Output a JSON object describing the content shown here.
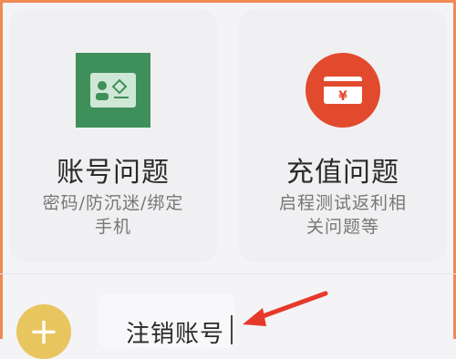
{
  "cards": [
    {
      "title": "账号问题",
      "description": "密码/防沉迷/绑定手机",
      "icon": "id-card-icon",
      "icon_color": "#3f8f5a"
    },
    {
      "title": "充值问题",
      "description": "启程测试返利相关问题等",
      "icon": "yen-card-icon",
      "icon_color": "#e24a2e"
    }
  ],
  "bottom": {
    "add_icon": "plus-icon",
    "add_color": "#e8c55e",
    "cancel_account_label": "注销账号"
  },
  "annotation": {
    "arrow_color": "#e53a2b"
  }
}
